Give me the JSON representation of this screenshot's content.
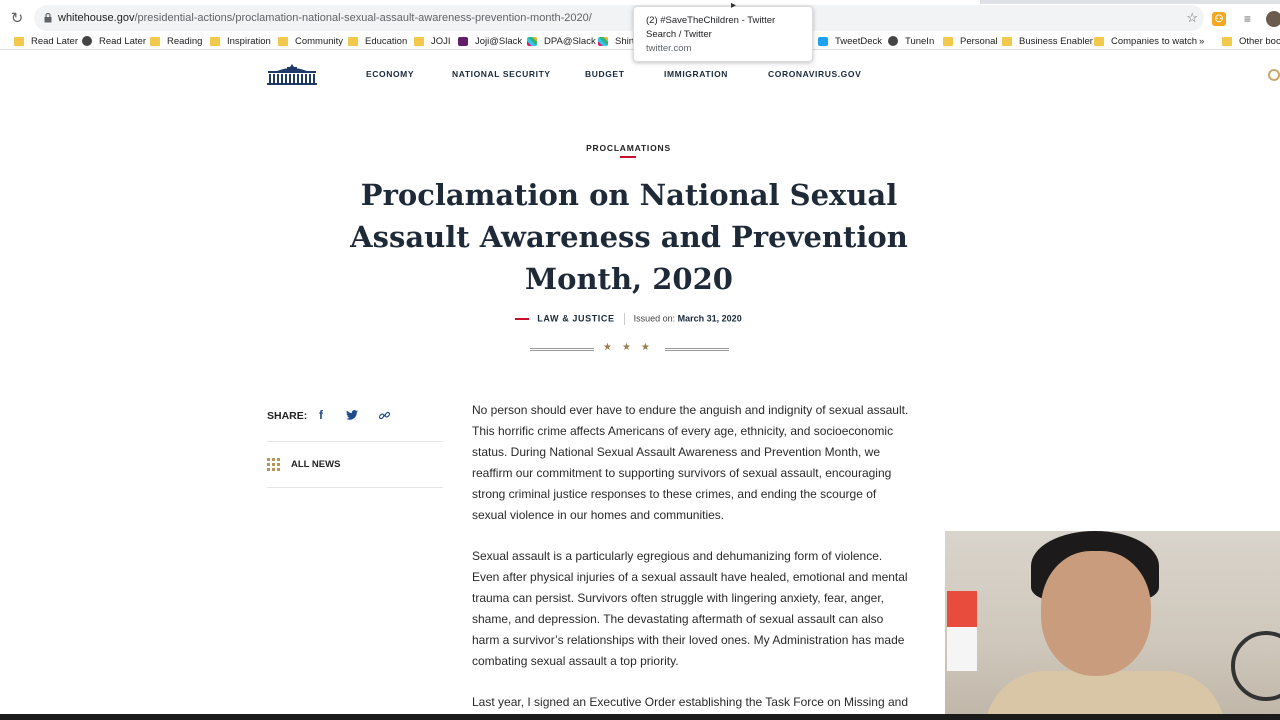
{
  "browser": {
    "url_domain": "whitehouse.gov",
    "url_path": "/presidential-actions/proclamation-national-sexual-assault-awareness-prevention-month-2020/",
    "bookmarks": [
      {
        "label": "Read Later",
        "icon": "folder"
      },
      {
        "label": "Read Later",
        "icon": "globe"
      },
      {
        "label": "Reading",
        "icon": "folder"
      },
      {
        "label": "Inspiration",
        "icon": "folder"
      },
      {
        "label": "Community",
        "icon": "folder"
      },
      {
        "label": "Education",
        "icon": "folder"
      },
      {
        "label": "JOJI",
        "icon": "folder"
      },
      {
        "label": "Joji@Slack",
        "icon": "joji"
      },
      {
        "label": "DPA@Slack",
        "icon": "slack"
      },
      {
        "label": "Shirt",
        "icon": "slack"
      },
      {
        "label": "TweetDeck",
        "icon": "twitter"
      },
      {
        "label": "TuneIn",
        "icon": "globe"
      },
      {
        "label": "Personal",
        "icon": "folder"
      },
      {
        "label": "Business Enabler",
        "icon": "folder"
      },
      {
        "label": "Companies to watch",
        "icon": "folder"
      },
      {
        "label": "»",
        "icon": "none"
      },
      {
        "label": "Other book",
        "icon": "folder"
      }
    ],
    "tooltip": {
      "title_line1": "(2) #SaveTheChildren - Twitter",
      "title_line2": "Search / Twitter",
      "url": "twitter.com"
    }
  },
  "site": {
    "nav": [
      "ECONOMY",
      "NATIONAL SECURITY",
      "BUDGET",
      "IMMIGRATION",
      "CORONAVIRUS.GOV"
    ]
  },
  "article": {
    "category": "PROCLAMATIONS",
    "title": "Proclamation on National Sexual Assault Awareness and Prevention Month, 2020",
    "topic": "LAW & JUSTICE",
    "issued_label": "Issued on:",
    "issued_date": "March 31, 2020",
    "paragraphs": [
      "No person should ever have to endure the anguish and indignity of sexual assault.  This horrific crime affects Americans of every age, ethnicity, and socioeconomic status.  During National Sexual Assault Awareness and Prevention Month, we reaffirm our commitment to supporting survivors of sexual assault, encouraging strong criminal justice responses to these crimes, and ending the scourge of sexual violence in our homes and communities.",
      "Sexual assault is a particularly egregious and dehumanizing form of violence.  Even after physical injuries of a sexual assault have healed, emotional and mental trauma can persist.  Survivors often struggle with lingering anxiety, fear, anger, shame, and depression.  The devastating aftermath of sexual assault can also harm a survivor’s relationships with their loved ones.  My Administration has made combating sexual assault a top priority.",
      "Last year, I signed an Executive Order establishing the Task Force on Missing and"
    ]
  },
  "sidebar": {
    "share_label": "SHARE:",
    "share_icons": [
      "facebook-icon",
      "twitter-icon",
      "link-icon"
    ],
    "all_news_label": "ALL NEWS"
  },
  "colors": {
    "accent_red": "#c8102e",
    "navy": "#1f2a38",
    "gold": "#b8945a"
  }
}
